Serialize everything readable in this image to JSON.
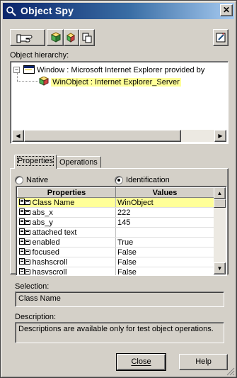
{
  "window": {
    "title": "Object Spy",
    "close_glyph": "✕"
  },
  "toolbar": {
    "buttons": [
      {
        "name": "pointing-hand-icon"
      },
      {
        "name": "add-object-icon"
      },
      {
        "name": "copy-icon"
      },
      {
        "name": "highlight-icon"
      }
    ]
  },
  "hierarchy": {
    "label": "Object hierarchy:",
    "nodes": [
      {
        "expander": "−",
        "text": "Window :  Microsoft Internet Explorer provided by"
      },
      {
        "text": "WinObject : Internet Explorer_Server"
      }
    ]
  },
  "tabs": [
    {
      "label": "Properties"
    },
    {
      "label": "Operations"
    }
  ],
  "mode": {
    "native_label": "Native",
    "identification_label": "Identification",
    "selected": "Identification"
  },
  "properties_table": {
    "columns": [
      "Properties",
      "Values"
    ],
    "rows": [
      {
        "property": "Class Name",
        "value": "WinObject"
      },
      {
        "property": "abs_x",
        "value": "222"
      },
      {
        "property": "abs_y",
        "value": "145"
      },
      {
        "property": "attached text",
        "value": ""
      },
      {
        "property": "enabled",
        "value": "True"
      },
      {
        "property": "focused",
        "value": "False"
      },
      {
        "property": "hashscroll",
        "value": "False"
      },
      {
        "property": "hasvscroll",
        "value": "False"
      }
    ]
  },
  "selection": {
    "label": "Selection:",
    "value": "Class Name"
  },
  "description": {
    "label": "Description:",
    "value": "Descriptions are available only for test object operations."
  },
  "buttons": {
    "close": "Close",
    "help": "Help"
  },
  "colors": {
    "title_bar": "#0a246a",
    "selected_row": "#ffff99",
    "face": "#d4d0c8"
  }
}
